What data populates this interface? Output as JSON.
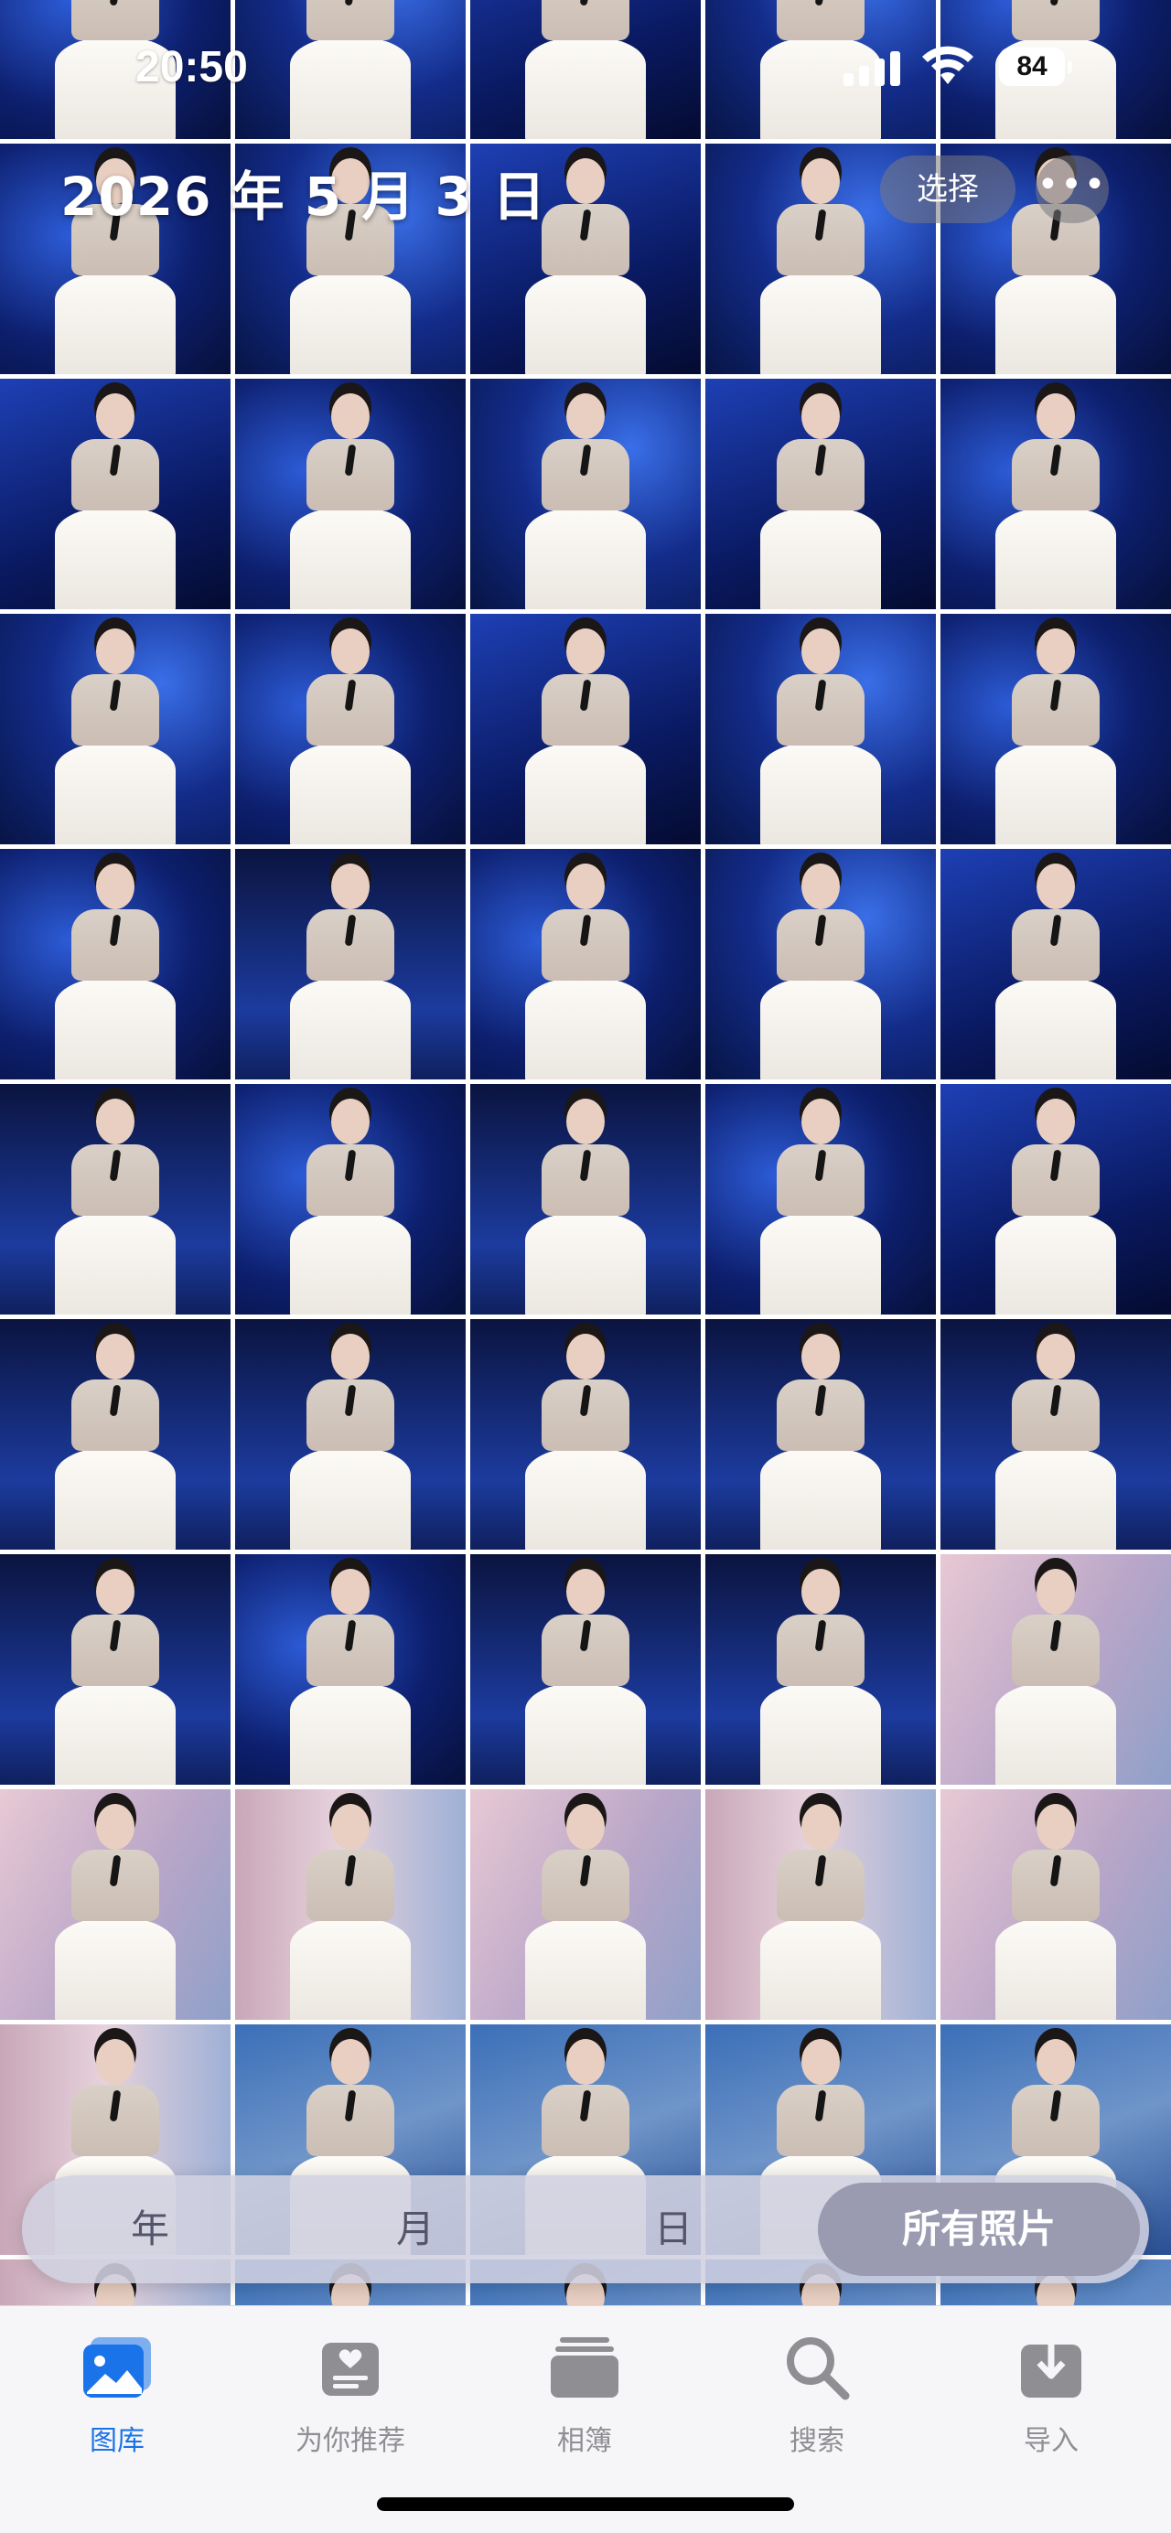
{
  "status_bar": {
    "time": "20:50",
    "battery": "84"
  },
  "header": {
    "date": "2026 年 5 月 3 日",
    "select_label": "选择",
    "more_label": "•••"
  },
  "grid": {
    "rows": [
      [
        "bg-blue1",
        "bg-blue2",
        "bg-blue3",
        "bg-blue2",
        "bg-blue1"
      ],
      [
        "bg-blue1",
        "bg-blue2",
        "bg-blue3",
        "bg-blue2",
        "bg-blue1"
      ],
      [
        "bg-blue3",
        "bg-blue1",
        "bg-blue2",
        "bg-blue3",
        "bg-blue1"
      ],
      [
        "bg-blue2",
        "bg-blue1",
        "bg-blue3",
        "bg-blue2",
        "bg-blue1"
      ],
      [
        "bg-blue1",
        "bg-navy",
        "bg-blue1",
        "bg-blue2",
        "bg-blue3"
      ],
      [
        "bg-navy",
        "bg-blue1",
        "bg-navy",
        "bg-blue1",
        "bg-blue3"
      ],
      [
        "bg-navy",
        "bg-navy",
        "bg-navy",
        "bg-navy",
        "bg-navy"
      ],
      [
        "bg-navy",
        "bg-blue1",
        "bg-navy",
        "bg-navy",
        "bg-pink"
      ],
      [
        "bg-pink",
        "bg-pinkb",
        "bg-pink",
        "bg-pinkb",
        "bg-pink"
      ],
      [
        "bg-pinkb",
        "bg-teal",
        "bg-teal",
        "bg-teal",
        "bg-teal"
      ],
      [
        "bg-pinkb",
        "bg-teal",
        "bg-teal",
        "bg-teal",
        "bg-teal"
      ]
    ]
  },
  "segmented": {
    "year": "年",
    "month": "月",
    "day": "日",
    "all": "所有照片",
    "selected": "所有照片"
  },
  "tabs": {
    "library": "图库",
    "for_you": "为你推荐",
    "albums": "相簿",
    "search": "搜索",
    "import": "导入",
    "active": "图库",
    "active_color": "#1a73e8"
  }
}
